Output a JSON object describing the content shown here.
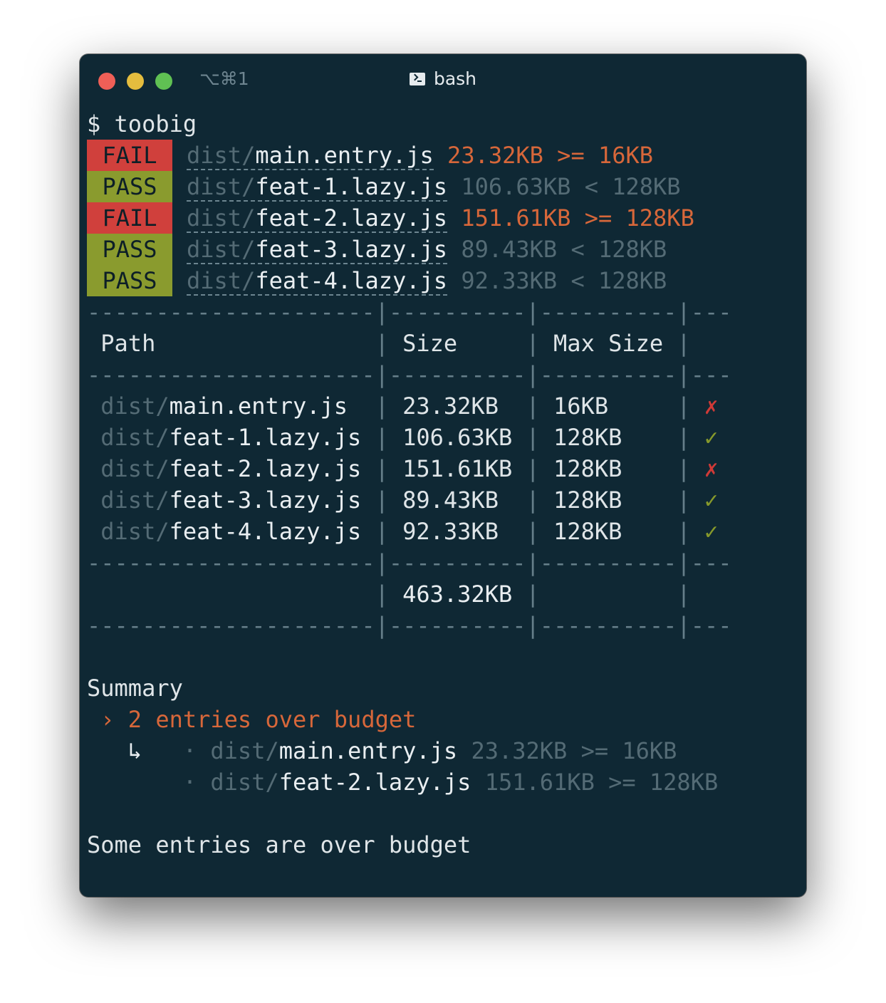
{
  "window": {
    "shortcut": "⌥⌘1",
    "title": "bash"
  },
  "prompt": "$ toobig",
  "results": [
    {
      "status": "FAIL",
      "dir": "dist/",
      "file": "main.entry.js",
      "size": "23.32KB",
      "op": ">=",
      "max": "16KB"
    },
    {
      "status": "PASS",
      "dir": "dist/",
      "file": "feat-1.lazy.js",
      "size": "106.63KB",
      "op": "<",
      "max": "128KB"
    },
    {
      "status": "FAIL",
      "dir": "dist/",
      "file": "feat-2.lazy.js",
      "size": "151.61KB",
      "op": ">=",
      "max": "128KB"
    },
    {
      "status": "PASS",
      "dir": "dist/",
      "file": "feat-3.lazy.js",
      "size": "89.43KB",
      "op": "<",
      "max": "128KB"
    },
    {
      "status": "PASS",
      "dir": "dist/",
      "file": "feat-4.lazy.js",
      "size": "92.33KB",
      "op": "<",
      "max": "128KB"
    }
  ],
  "table": {
    "headers": [
      "Path",
      "Size",
      "Max Size",
      ""
    ],
    "rows": [
      {
        "dir": "dist/",
        "file": "main.entry.js",
        "size": "23.32KB",
        "max": "16KB",
        "mark": "✗",
        "ok": false
      },
      {
        "dir": "dist/",
        "file": "feat-1.lazy.js",
        "size": "106.63KB",
        "max": "128KB",
        "mark": "✓",
        "ok": true
      },
      {
        "dir": "dist/",
        "file": "feat-2.lazy.js",
        "size": "151.61KB",
        "max": "128KB",
        "mark": "✗",
        "ok": false
      },
      {
        "dir": "dist/",
        "file": "feat-3.lazy.js",
        "size": "89.43KB",
        "max": "128KB",
        "mark": "✓",
        "ok": true
      },
      {
        "dir": "dist/",
        "file": "feat-4.lazy.js",
        "size": "92.33KB",
        "max": "128KB",
        "mark": "✓",
        "ok": true
      }
    ],
    "total": "463.32KB"
  },
  "summary": {
    "heading": "Summary",
    "over": "› 2 entries over budget",
    "arrow": "↳",
    "bullet": "·",
    "items": [
      {
        "dir": "dist/",
        "file": "main.entry.js",
        "detail": "23.32KB >= 16KB"
      },
      {
        "dir": "dist/",
        "file": "feat-2.lazy.js",
        "detail": "151.61KB >= 128KB"
      }
    ],
    "footer": "Some entries are over budget"
  },
  "colors": {
    "background": "#0f2834",
    "fail": "#d0403c",
    "pass": "#8a9b2e",
    "over_budget": "#d7673a",
    "dim": "#546b75"
  }
}
